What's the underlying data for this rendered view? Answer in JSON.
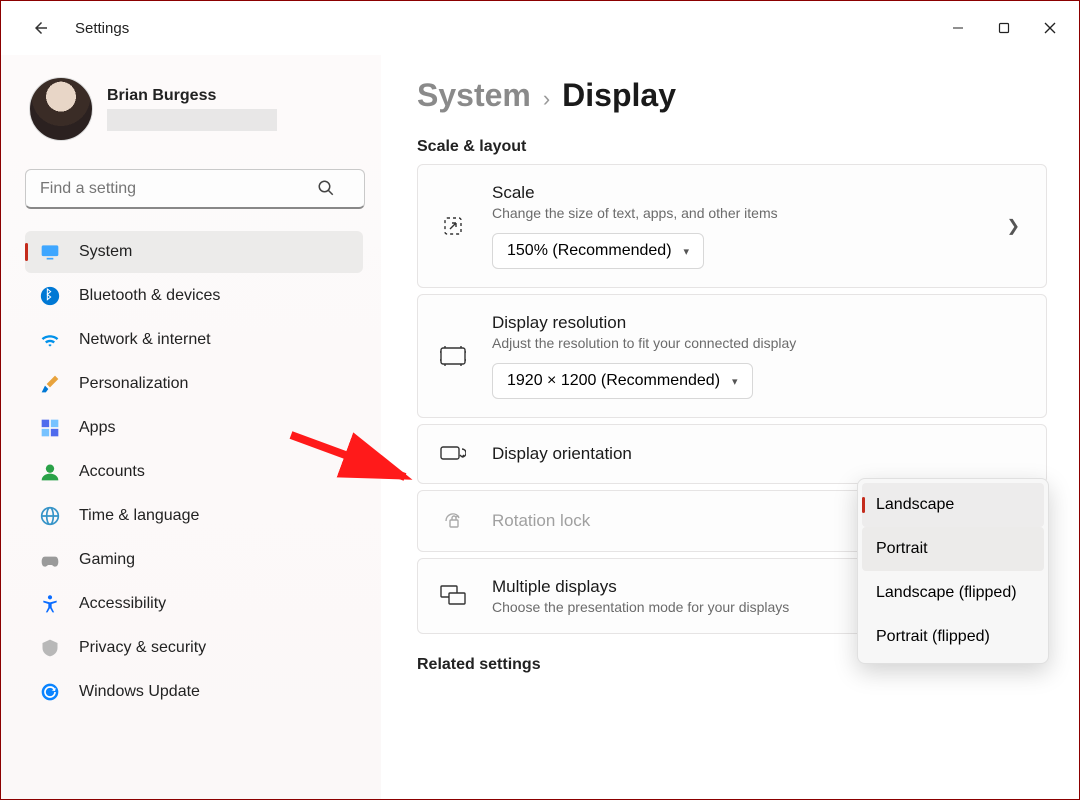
{
  "window": {
    "title": "Settings",
    "minimize": "—",
    "maximize": "▢",
    "close": "✕"
  },
  "user": {
    "name": "Brian Burgess"
  },
  "search": {
    "placeholder": "Find a setting"
  },
  "sidebar": {
    "items": [
      {
        "label": "System",
        "icon": "monitor",
        "color": "#0078d4",
        "selected": true
      },
      {
        "label": "Bluetooth & devices",
        "icon": "bluetooth",
        "color": "#0078d4"
      },
      {
        "label": "Network & internet",
        "icon": "wifi",
        "color": "#0078d4"
      },
      {
        "label": "Personalization",
        "icon": "brush",
        "color": "#e8a33d"
      },
      {
        "label": "Apps",
        "icon": "apps",
        "color": "#4f6bed"
      },
      {
        "label": "Accounts",
        "icon": "person",
        "color": "#2aa148"
      },
      {
        "label": "Time & language",
        "icon": "globe",
        "color": "#3694c8"
      },
      {
        "label": "Gaming",
        "icon": "gamepad",
        "color": "#888"
      },
      {
        "label": "Accessibility",
        "icon": "accessibility",
        "color": "#0a6cff"
      },
      {
        "label": "Privacy & security",
        "icon": "shield",
        "color": "#8a8a8a"
      },
      {
        "label": "Windows Update",
        "icon": "update",
        "color": "#0a84ff"
      }
    ]
  },
  "breadcrumb": {
    "parent": "System",
    "separator": "›",
    "current": "Display"
  },
  "section1_title": "Scale & layout",
  "cards": {
    "scale": {
      "title": "Scale",
      "desc": "Change the size of text, apps, and other items",
      "value": "150% (Recommended)"
    },
    "resolution": {
      "title": "Display resolution",
      "desc": "Adjust the resolution to fit your connected display",
      "value": "1920 × 1200 (Recommended)"
    },
    "orientation": {
      "title": "Display orientation"
    },
    "rotation": {
      "title": "Rotation lock"
    },
    "multiple": {
      "title": "Multiple displays",
      "desc": "Choose the presentation mode for your displays"
    }
  },
  "orientation_options": [
    {
      "label": "Landscape",
      "selected": true
    },
    {
      "label": "Portrait",
      "hover": true
    },
    {
      "label": "Landscape (flipped)"
    },
    {
      "label": "Portrait (flipped)"
    }
  ],
  "section2_title": "Related settings"
}
